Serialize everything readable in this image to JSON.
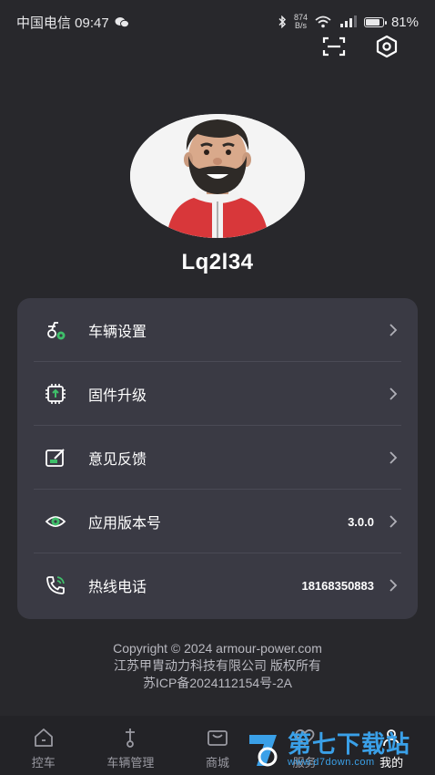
{
  "status_bar": {
    "carrier_time": "中国电信 09:47",
    "net_speed_top": "874",
    "net_speed_bottom": "B/s",
    "battery_percent": "81%",
    "battery_level": 0.81
  },
  "profile": {
    "username": "Lq2l34"
  },
  "menu": {
    "items": [
      {
        "label": "车辆设置",
        "value": "",
        "icon": "vehicle-settings-icon"
      },
      {
        "label": "固件升级",
        "value": "",
        "icon": "firmware-chip-icon"
      },
      {
        "label": "意见反馈",
        "value": "",
        "icon": "feedback-edit-icon"
      },
      {
        "label": "应用版本号",
        "value": "3.0.0",
        "icon": "app-version-icon"
      },
      {
        "label": "热线电话",
        "value": "18168350883",
        "icon": "phone-icon"
      }
    ]
  },
  "footer": {
    "line1": "Copyright © 2024  armour-power.com",
    "line2": "江苏甲胄动力科技有限公司 版权所有",
    "line3": "苏ICP备2024112154号-2A"
  },
  "tabs": [
    {
      "label": "控车",
      "icon": "home-icon",
      "active": false
    },
    {
      "label": "车辆管理",
      "icon": "scooter-icon",
      "active": false
    },
    {
      "label": "商城",
      "icon": "shop-icon",
      "active": false
    },
    {
      "label": "服务",
      "icon": "service-icon",
      "active": false
    },
    {
      "label": "我的",
      "icon": "user-icon",
      "active": true
    }
  ],
  "watermark": {
    "title": "第七下载站",
    "url": "www.d7down.com"
  },
  "colors": {
    "background": "#28282c",
    "card": "#3a3a44",
    "accent_green": "#3fbf6a",
    "watermark_blue": "#3aa0e8"
  }
}
